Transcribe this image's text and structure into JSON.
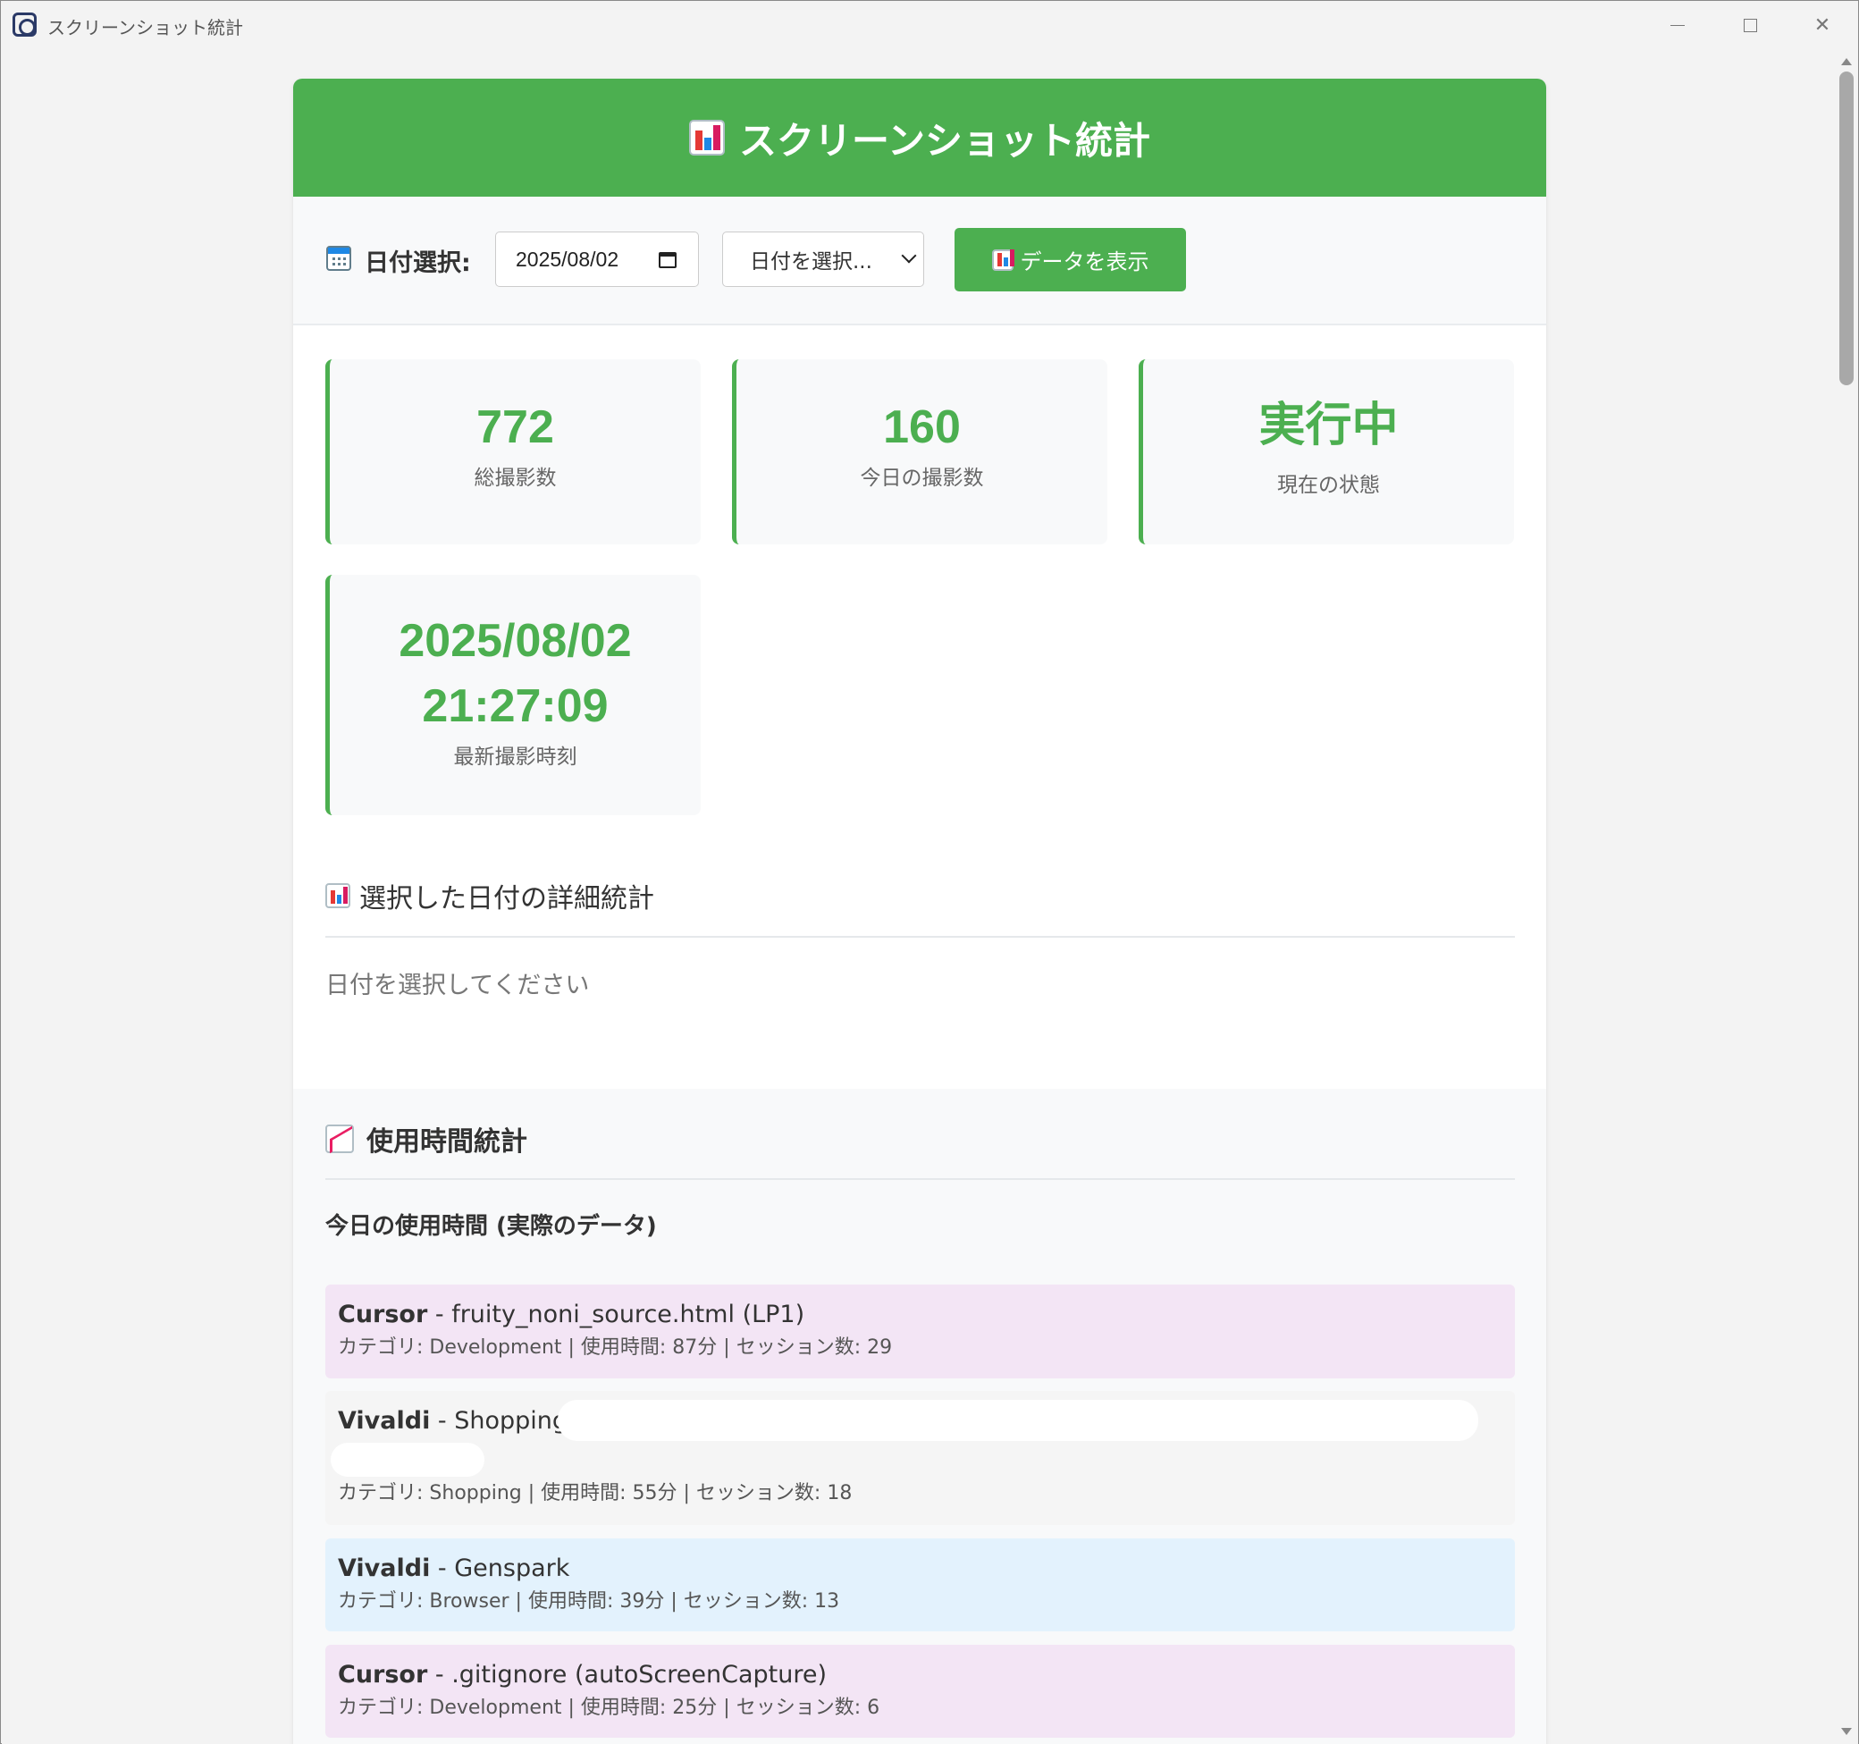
{
  "window": {
    "title": "スクリーンショット統計"
  },
  "header": {
    "title": "スクリーンショット統計"
  },
  "date_bar": {
    "label": "日付選択:",
    "date_value": "2025/08/02",
    "select_value": "日付を選択...",
    "show_button": "データを表示"
  },
  "stats": [
    {
      "value": "772",
      "label": "総撮影数"
    },
    {
      "value": "160",
      "label": "今日の撮影数"
    },
    {
      "value": "実行中",
      "label": "現在の状態"
    },
    {
      "value_line1": "2025/08/02",
      "value_line2": "21:27:09",
      "label": "最新撮影時刻"
    }
  ],
  "detail_section": {
    "title": "選択した日付の詳細統計",
    "placeholder": "日付を選択してください"
  },
  "usage_section": {
    "title": "使用時間統計",
    "subtitle": "今日の使用時間 (実際のデータ)",
    "items": [
      {
        "app": "Cursor",
        "detail": " - fruity_noni_source.html (LP1)",
        "meta": "カテゴリ: Development | 使用時間: 87分 | セッション数: 29",
        "color": "#f3e5f5"
      },
      {
        "app": "Vivaldi",
        "detail": " - Shopping:",
        "meta": "カテゴリ: Shopping | 使用時間: 55分 | セッション数: 18",
        "color": "#f5f5f5"
      },
      {
        "app": "Vivaldi",
        "detail": " - Genspark",
        "meta": "カテゴリ: Browser | 使用時間: 39分 | セッション数: 13",
        "color": "#e3f2fd"
      },
      {
        "app": "Cursor",
        "detail": " - .gitignore (autoScreenCapture)",
        "meta": "カテゴリ: Development | 使用時間: 25分 | セッション数: 6",
        "color": "#f3e5f5"
      }
    ]
  },
  "colors": {
    "accent": "#4caf50",
    "development": "#f3e5f5",
    "shopping": "#f5f5f5",
    "browser": "#e3f2fd"
  }
}
